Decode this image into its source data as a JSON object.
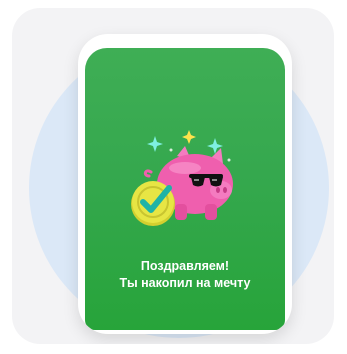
{
  "screen": {
    "headline_line1": "Поздравляем!",
    "headline_line2": "Ты накопил на мечту"
  },
  "colors": {
    "card_bg": "#f3f3f5",
    "circle_bg": "#dbe8f7",
    "screen_green": "#35a84e",
    "pig_pink": "#ef5fae",
    "coin_yellow": "#e7e544",
    "check_teal": "#1fb3a6"
  },
  "icons": [
    "piggy-bank-icon",
    "sunglasses-icon",
    "coin-check-icon",
    "sparkle-icon"
  ]
}
